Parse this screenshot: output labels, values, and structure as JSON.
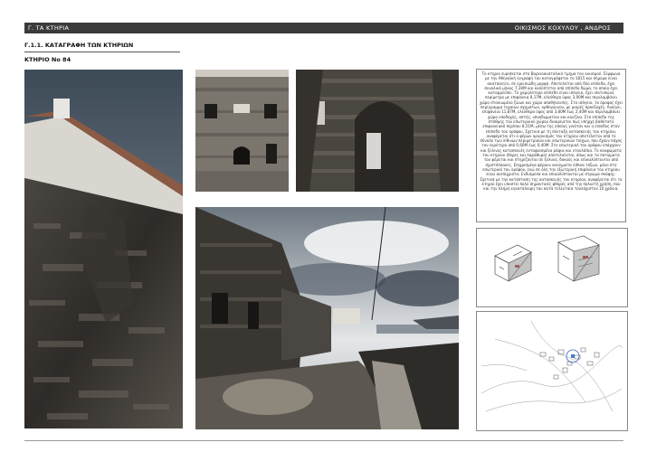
{
  "header": {
    "left_title": "Γ. ΤΑ ΚΤΗΡΙΑ",
    "right_title": "ΟΙΚΙΣΜΟΣ ΚΟΧΥΛΟΥ , ΑΝΔΡΟΣ"
  },
  "section_title": "Γ.1.1. ΚΑΤΑΓΡΑΦΗ ΤΩΝ ΚΤΗΡΙΩΝ",
  "building_label": "ΚΤΗΡΙΟ Νο 84",
  "description": "Το κτηριο ευρίσκεται στο Βορειοανατολικό τμήμα του οικισμού. Σύμφωνα με την Αθηναϊκή εγγραφή του καταγράφεται το 1815 και σήμερα είναι ακατοίκητο, σε ερειπιώδη μορφή. Αποτελείται από δύο επίπεδα, έχει συνολικό μήκος 7,30Μ και καλύπτεται από επίπεδο δώμα, το οποίο έχει καταρρεύσει. Το χαμηλότερο επίπεδο είναι ισόγειο, έχει ισοτυπώνη περίμετρο με επιφάνεια 9,17Μ, ελεύθερο ύψος 3,00Μ και περιλαμβάνει χώρο στοκιωμένο ζώων και χώρο αποθήκευσης. Στο ισόγειο, το όροφος έχει περίγραμμα τυχαίων σχημάτων, ορθογώνιου, με μικρές προεξοχές. Ανοίγει, επιφάνεια 11,87Μ, ελεύθερο ύψος από 3,80Μ έως 2,40Μ και περιλαμβάνει χώρο υποδοχής, οπτής, υπνοδωματίου και κουζίνα. Στο επίπεδο της στάθμης του εσωτερικού χώρου διακρίνεται πως υπήρχε βαθύτατο επιφανειακό περίπου 8,51Μ, μέσω της οποίας γινόταν και η είσοδος στον επίπεδο του ορόφου. Σχετικά με τη σύνταξη κατασκευής του κτηρίου, αναφέρεται ότι ο φέρων οργανισμός του κτηρίου αποτελείται από το σύνολο των λίθινων περιμετρικών και εσωτερικών τοίχων, που έχουν πάχος τον ευρύτερο από 0,60Μ έως 0,40Μ. Στο εσωτερικό του ορόφου υπάρχουν και ξύλινες κατασκευές ενταφιασμένα ράφια και ντουλάπια. Το κουφώματα του κτηρίου (θύρες και παράθυρα) αποτελούνται, όπως και τα πατώματα του φέρεται και στηρίζονται σε ξύλινες δοκούς και επικαλύπτονται από σχιστόπλακες. Επιχρισμένα φέρουν ανοίγματα λίθινα τόξων, μόνο στο εσωτερικό του ορόφου, ενώ σε όλη την εξωτερική επιφάνεια του κτηρίου είναι ανεπίχριστο. Ενδιάμεσα και επικαλύπτονται με στρώμα σκάφης. Σχετικά με την κατάσταση της κατασκευής του κτηρίου, αναφέρεται ότι το κτηρίο έχει υποστεί πολύ σημαντικές φθορές από την πολυετή χρήση, που και την πλήρη εγκατάλειψη του κατά τελευταία τουλάχιστον 10 χρόνια."
}
